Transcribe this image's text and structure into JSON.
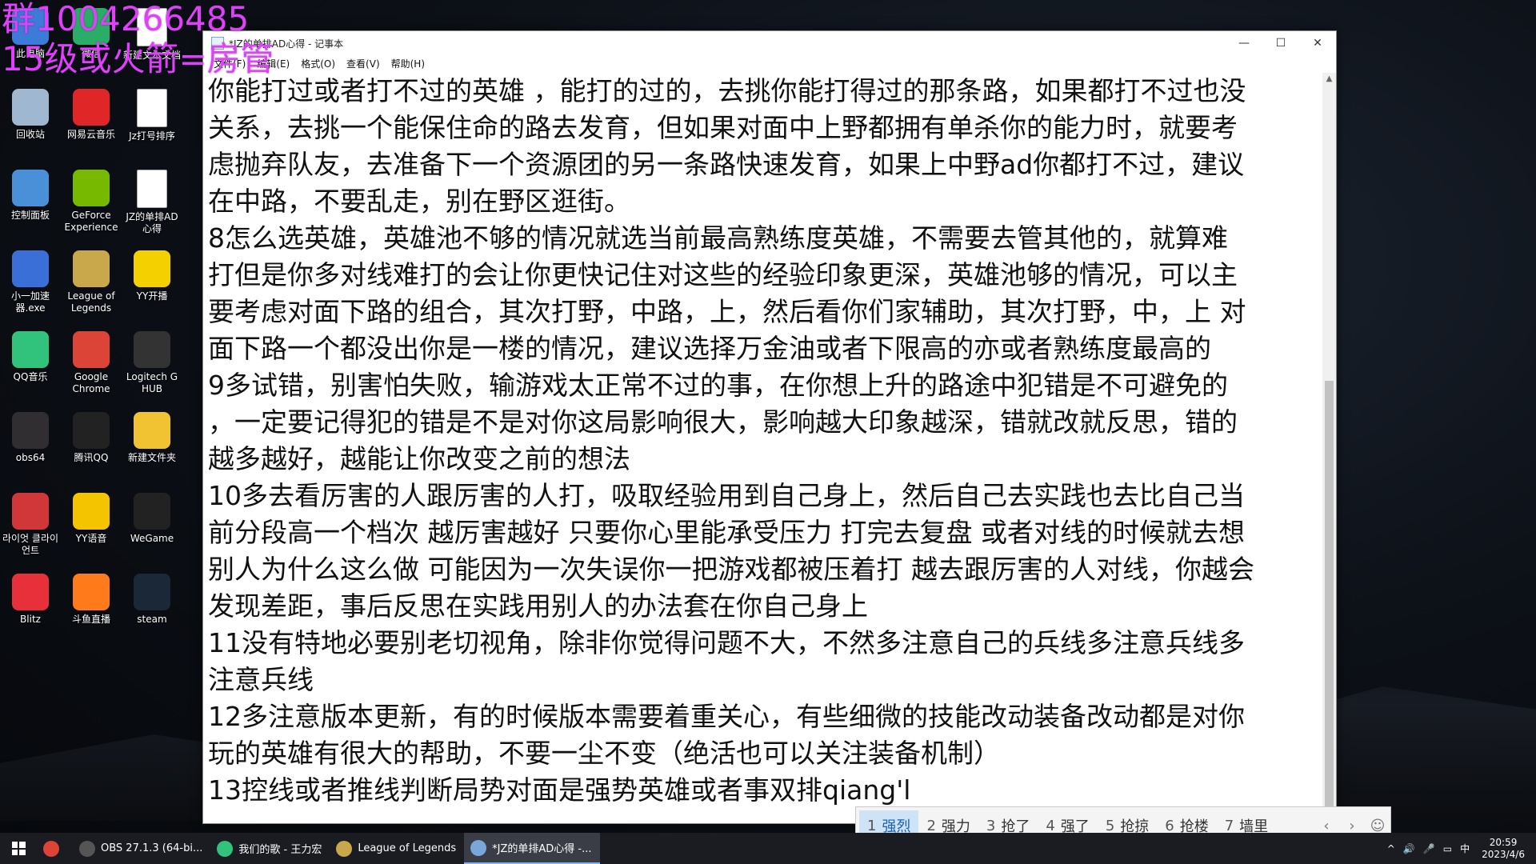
{
  "overlay": {
    "line1": "群1004266485",
    "line2": "15级或火箭=房管"
  },
  "desktop_icons": [
    {
      "label": "此电脑",
      "icon": "computer-icon",
      "color": "#3d7bd9"
    },
    {
      "label": "微信",
      "icon": "wechat-icon",
      "color": "#2aae67"
    },
    {
      "label": "新建文本文档",
      "icon": "text-file-icon",
      "color": "#ffffff"
    },
    {
      "label": "回收站",
      "icon": "recycle-bin-icon",
      "color": "#9fb7d0"
    },
    {
      "label": "网易云音乐",
      "icon": "netease-music-icon",
      "color": "#e02626"
    },
    {
      "label": "Jz打号排序",
      "icon": "text-file-icon",
      "color": "#ffffff"
    },
    {
      "label": "控制面板",
      "icon": "control-panel-icon",
      "color": "#4a90d9"
    },
    {
      "label": "GeForce Experience",
      "icon": "nvidia-icon",
      "color": "#76b900"
    },
    {
      "label": "JZ的单排AD心得",
      "icon": "text-file-icon",
      "color": "#ffffff"
    },
    {
      "label": "小一加速器.exe",
      "icon": "accelerator-icon",
      "color": "#3a6fd8"
    },
    {
      "label": "League of Legends",
      "icon": "league-of-legends-icon",
      "color": "#c8a84b"
    },
    {
      "label": "YY开播",
      "icon": "yy-live-icon",
      "color": "#f5d000"
    },
    {
      "label": "QQ音乐",
      "icon": "qq-music-icon",
      "color": "#31c27c"
    },
    {
      "label": "Google Chrome",
      "icon": "chrome-icon",
      "color": "#db4437"
    },
    {
      "label": "Logitech G HUB",
      "icon": "logitech-icon",
      "color": "#333333"
    },
    {
      "label": "obs64",
      "icon": "obs-icon",
      "color": "#302e31"
    },
    {
      "label": "腾讯QQ",
      "icon": "qq-icon",
      "color": "#222222"
    },
    {
      "label": "新建文件夹",
      "icon": "folder-icon",
      "color": "#f1c232"
    },
    {
      "label": "라이엇 클라이언트",
      "icon": "riot-client-icon",
      "color": "#d13639"
    },
    {
      "label": "YY语音",
      "icon": "yy-voice-icon",
      "color": "#f5c400"
    },
    {
      "label": "WeGame",
      "icon": "wegame-icon",
      "color": "#222222"
    },
    {
      "label": "Blitz",
      "icon": "blitz-icon",
      "color": "#e8303a"
    },
    {
      "label": "斗鱼直播",
      "icon": "douyu-icon",
      "color": "#ff7a1a"
    },
    {
      "label": "steam",
      "icon": "steam-icon",
      "color": "#1b2838"
    }
  ],
  "window": {
    "title": "*JZ的单排AD心得 - 记事本",
    "minimize": "—",
    "maximize": "☐",
    "close": "✕",
    "menu": [
      "文件(F)",
      "编辑(E)",
      "格式(O)",
      "查看(V)",
      "帮助(H)"
    ]
  },
  "document_lines": [
    "你能打过或者打不过的英雄 ，能打的过的，去挑你能打得过的那条路，如果都打不过也没",
    "关系，去挑一个能保住命的路去发育，但如果对面中上野都拥有单杀你的能力时，就要考",
    "虑抛弃队友，去准备下一个资源团的另一条路快速发育，如果上中野ad你都打不过，建议",
    "在中路，不要乱走，别在野区逛街。",
    "8怎么选英雄，英雄池不够的情况就选当前最高熟练度英雄，不需要去管其他的，就算难",
    "打但是你多对线难打的会让你更快记住对这些的经验印象更深，英雄池够的情况，可以主",
    "要考虑对面下路的组合，其次打野，中路，上，然后看你们家辅助，其次打野，中，上 对",
    "面下路一个都没出你是一楼的情况，建议选择万金油或者下限高的亦或者熟练度最高的",
    "9多试错，别害怕失败，输游戏太正常不过的事，在你想上升的路途中犯错是不可避免的",
    "，一定要记得犯的错是不是对你这局影响很大，影响越大印象越深，错就改就反思，错的",
    "越多越好，越能让你改变之前的想法",
    "10多去看厉害的人跟厉害的人打，吸取经验用到自己身上，然后自己去实践也去比自己当",
    "前分段高一个档次 越厉害越好 只要你心里能承受压力 打完去复盘 或者对线的时候就去想",
    "别人为什么这么做 可能因为一次失误你一把游戏都被压着打 越去跟厉害的人对线，你越会",
    "发现差距，事后反思在实践用别人的办法套在你自己身上",
    "11没有特地必要别老切视角，除非你觉得问题不大，不然多注意自己的兵线多注意兵线多",
    "注意兵线",
    "12多注意版本更新，有的时候版本需要着重关心，有些细微的技能改动装备改动都是对你",
    "玩的英雄有很大的帮助，不要一尘不变（绝活也可以关注装备机制）",
    "13控线或者推线判断局势对面是强势英雄或者事双排qiang'l"
  ],
  "ime": {
    "candidates": [
      {
        "num": "1",
        "text": "强烈"
      },
      {
        "num": "2",
        "text": "强力"
      },
      {
        "num": "3",
        "text": "抢了"
      },
      {
        "num": "4",
        "text": "强了"
      },
      {
        "num": "5",
        "text": "抢掠"
      },
      {
        "num": "6",
        "text": "抢楼"
      },
      {
        "num": "7",
        "text": "墙里"
      }
    ],
    "prev": "‹",
    "next": "›",
    "emoji": "☺"
  },
  "taskbar": {
    "items": [
      {
        "label": "",
        "icon": "chrome-icon",
        "color": "#db4437"
      },
      {
        "label": "OBS 27.1.3 (64-bi...",
        "icon": "obs-icon",
        "color": "#555"
      },
      {
        "label": "我们的歌 - 王力宏",
        "icon": "qq-music-icon",
        "color": "#31c27c"
      },
      {
        "label": "League of Legends",
        "icon": "league-of-legends-icon",
        "color": "#c8a84b"
      },
      {
        "label": "*JZ的单排AD心得 -...",
        "icon": "notepad-icon",
        "color": "#7aa7d9"
      }
    ],
    "tray": {
      "chevron": "^",
      "volume": "🔊",
      "mic": "🎤",
      "network": "▭",
      "ime_mode": "中",
      "time": "20:59",
      "date": "2023/4/6"
    }
  }
}
